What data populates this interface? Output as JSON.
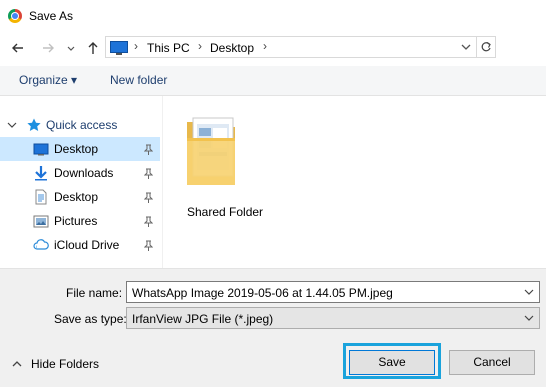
{
  "window": {
    "title": "Save As",
    "app_icon": "chrome-icon"
  },
  "navigation": {
    "back_icon": "arrow-left-icon",
    "forward_icon": "arrow-right-icon",
    "recent_icon": "chevron-down-icon",
    "up_icon": "arrow-up-icon",
    "breadcrumb": [
      "This PC",
      "Desktop"
    ],
    "refresh_icon": "refresh-icon"
  },
  "toolbar": {
    "organize": "Organize ▾",
    "new_folder": "New folder"
  },
  "sidebar": {
    "quick_access": "Quick access",
    "items": [
      {
        "label": "Desktop",
        "icon": "desktop-icon",
        "pinned": true,
        "selected": true
      },
      {
        "label": "Downloads",
        "icon": "download-icon",
        "pinned": true,
        "selected": false
      },
      {
        "label": "Desktop",
        "icon": "document-icon",
        "pinned": true,
        "selected": false
      },
      {
        "label": "Pictures",
        "icon": "pictures-icon",
        "pinned": true,
        "selected": false
      },
      {
        "label": "iCloud Drive",
        "icon": "icloud-icon",
        "pinned": true,
        "selected": false
      }
    ]
  },
  "content": {
    "items": [
      {
        "label": "Shared Folder",
        "icon": "folder-icon"
      }
    ]
  },
  "footer": {
    "file_name_label": "File name:",
    "file_name_value": "WhatsApp Image 2019-05-06 at 1.44.05 PM.jpeg",
    "save_type_label": "Save as type:",
    "save_type_value": "IrfanView JPG File (*.jpeg)",
    "hide_folders": "Hide Folders",
    "save": "Save",
    "cancel": "Cancel"
  },
  "colors": {
    "selection": "#cce8ff",
    "highlight": "#1aa3dc",
    "accent": "#0078d7"
  }
}
